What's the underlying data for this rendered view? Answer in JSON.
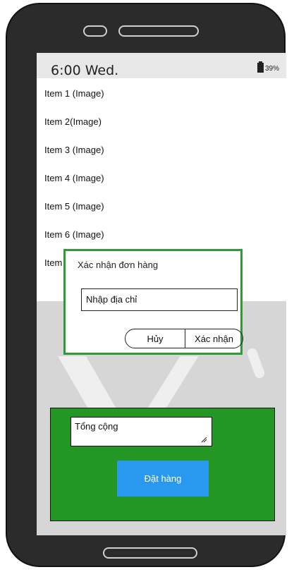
{
  "status_bar": {
    "time": "6:00  Wed.",
    "battery_percent": "39%",
    "battery_icon": "battery-icon"
  },
  "list": {
    "items": [
      "Item 1 (Image)",
      "Item 2(Image)",
      "Item 3 (Image)",
      "Item 4 (Image)",
      "Item 5 (Image)",
      "Item 6 (Image)",
      "Item"
    ]
  },
  "dialog": {
    "title": "Xác nhận đơn hàng",
    "address_value": "Nhập địa chỉ",
    "cancel_label": "Hủy",
    "confirm_label": "Xác nhận",
    "border_color": "#2e9a38"
  },
  "order_panel": {
    "total_value": "Tổng cộng",
    "order_button_label": "Đặt hàng",
    "panel_color": "#239623",
    "button_color": "#2999f0"
  }
}
